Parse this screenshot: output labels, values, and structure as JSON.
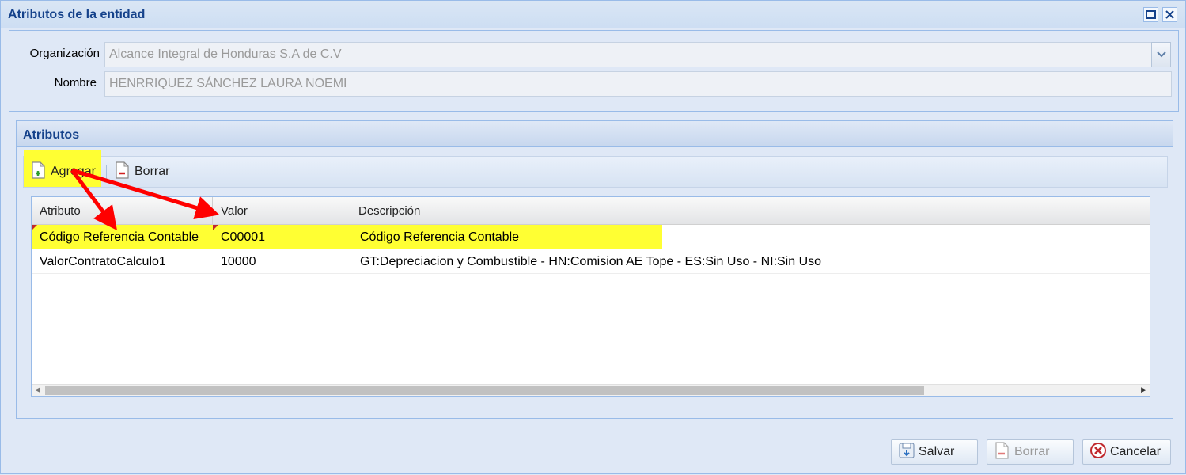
{
  "window": {
    "title": "Atributos de la entidad"
  },
  "form": {
    "organizacion_label": "Organización",
    "organizacion_value": "Alcance Integral de Honduras S.A de C.V",
    "nombre_label": "Nombre",
    "nombre_value": "HENRRIQUEZ SÁNCHEZ LAURA NOEMI"
  },
  "panel": {
    "title": "Atributos",
    "toolbar": {
      "add_label": "Agregar",
      "delete_label": "Borrar"
    },
    "grid": {
      "columns": [
        "Atributo",
        "Valor",
        "Descripción"
      ],
      "rows": [
        {
          "atributo": "Código Referencia Contable",
          "valor": "C00001",
          "descripcion": "Código Referencia Contable"
        },
        {
          "atributo": "ValorContratoCalculo1",
          "valor": "10000",
          "descripcion": "GT:Depreciacion y Combustible - HN:Comision AE Tope - ES:Sin Uso - NI:Sin Uso"
        }
      ]
    }
  },
  "footer": {
    "save_label": "Salvar",
    "delete_label": "Borrar",
    "cancel_label": "Cancelar"
  },
  "colors": {
    "title_blue": "#15428b",
    "highlight_yellow": "#ffff33",
    "annotation_red": "#ff0000"
  }
}
